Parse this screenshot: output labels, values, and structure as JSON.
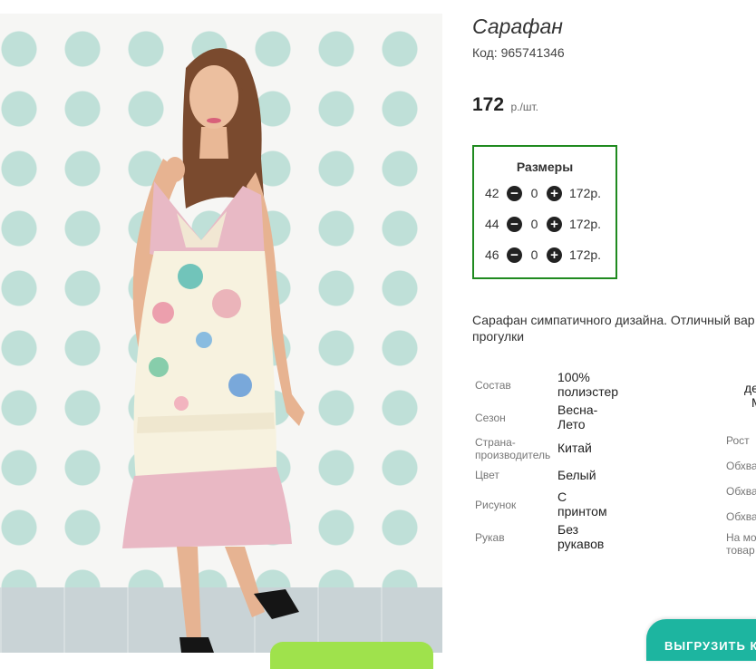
{
  "product": {
    "title": "Сарафан",
    "code": "Код: 965741346",
    "price": "172",
    "price_unit": "р./шт."
  },
  "sizes": {
    "title": "Размеры",
    "rows": [
      {
        "size": "42",
        "qty": "0",
        "price": "172р."
      },
      {
        "size": "44",
        "qty": "0",
        "price": "172р."
      },
      {
        "size": "46",
        "qty": "0",
        "price": "172р."
      }
    ]
  },
  "description": "Сарафан симпатичного дизайна. Отличный вар прогулки",
  "properties": [
    {
      "label": "Состав",
      "value": "100% полиэстер"
    },
    {
      "label": "Сезон",
      "value": "Весна-Лето"
    },
    {
      "label": "Страна-производитель",
      "value": "Китай"
    },
    {
      "label": "Цвет",
      "value": "Белый"
    },
    {
      "label": "Рисунок",
      "value": "С принтом"
    },
    {
      "label": "Рукав",
      "value": "Без рукавов"
    }
  ],
  "properties_right": {
    "partial_value_1": "де",
    "partial_value_2": "М",
    "labels": [
      "Рост",
      "Обхва",
      "Обхва",
      "Обхва",
      "На мо товар"
    ]
  },
  "buttons": {
    "export": "ВЫГРУЗИТЬ К"
  },
  "icons": {
    "minus": "minus-circle-icon",
    "plus": "plus-circle-icon"
  },
  "colors": {
    "sizes_border": "#1f8a1f",
    "export_button": "#1db5a0",
    "photo_button": "#9fe24c",
    "polka_dot": "#bfe0d8"
  }
}
